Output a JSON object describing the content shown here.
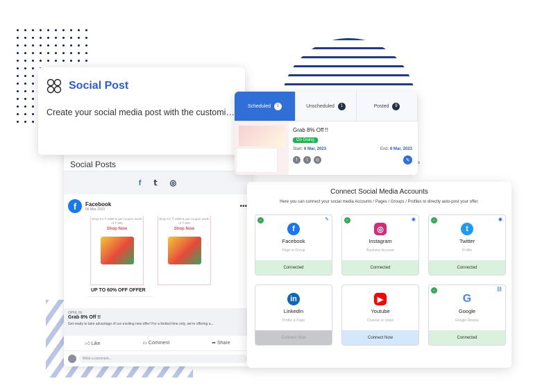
{
  "social_post_card": {
    "title": "Social Post",
    "description": "Create your social media post with the customizable template available and post it on for…"
  },
  "scheduled_card": {
    "tabs": [
      {
        "label": "Scheduled",
        "count": "1"
      },
      {
        "label": "Unscheduled",
        "count": "1"
      },
      {
        "label": "Posted",
        "count": "9"
      }
    ],
    "post_title": "Grab 8% Off !!",
    "status": "On Going",
    "start_label": "Start:",
    "start_date": "6 Mar, 2023",
    "end_label": "End:",
    "end_date": "6 Mar, 2023",
    "peek_text": "s"
  },
  "social_posts": {
    "heading": "Social Posts",
    "networks": [
      "facebook-icon",
      "twitter-icon",
      "instagram-icon"
    ],
    "post": {
      "page_name": "Facebook",
      "date": "06 Mar 2023",
      "offer_text": "Shop for ₹ 1999 & get coupon worth of ₹ 999",
      "shop_now": "Shop Now",
      "banner": "UP TO 60% OFF OFFER",
      "link_domain": "OPNL.IN",
      "link_title": "Grab 8% Off !!",
      "link_desc": "Get ready to take advantage of our exciting new offer! For a limited time only, we're offering a...",
      "like": "Like",
      "comment": "Comment",
      "share": "Share",
      "comment_placeholder": "Write a comment..."
    }
  },
  "connect": {
    "title": "Connect Social Media Accounts",
    "subtitle": "Here you can connect your social media Accounts / Pages / Groups / Profiles to directly auto-post your offer.",
    "accounts": [
      {
        "name": "Facebook",
        "sub": "Page or Group",
        "status": "Connected",
        "color": "#1877f2",
        "icon": "facebook-icon",
        "corner": "pencil-icon"
      },
      {
        "name": "Instagram",
        "sub": "Business Account",
        "status": "Connected",
        "color": "#d62976",
        "icon": "instagram-icon",
        "corner": "eye-icon"
      },
      {
        "name": "Twitter",
        "sub": "Profile",
        "status": "Connected",
        "color": "#1d9bf0",
        "icon": "twitter-icon",
        "corner": "eye-icon"
      },
      {
        "name": "LinkedIn",
        "sub": "Profile & Page",
        "status": "Connect Now",
        "color": "#0a66c2",
        "icon": "linkedin-icon",
        "corner": ""
      },
      {
        "name": "Youtube",
        "sub": "Channel or Video",
        "status": "Connect Now",
        "color": "#ff0000",
        "icon": "youtube-icon",
        "corner": ""
      },
      {
        "name": "Google",
        "sub": "Google Review",
        "status": "Connected",
        "color": "#4285f4",
        "icon": "google-icon",
        "corner": "link-icon"
      }
    ]
  }
}
